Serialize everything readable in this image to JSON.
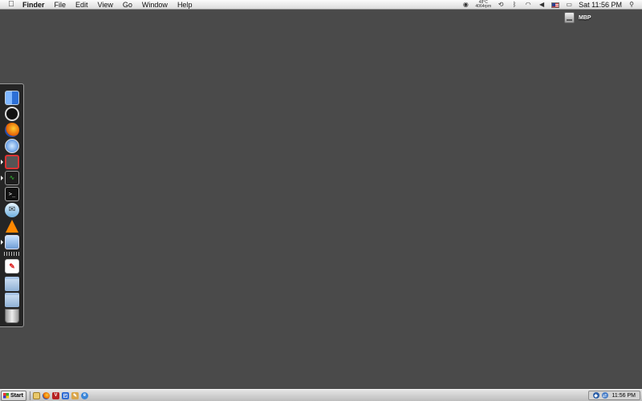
{
  "menubar": {
    "apple_icon": "apple-icon",
    "app_name": "Finder",
    "menus": [
      "File",
      "Edit",
      "View",
      "Go",
      "Window",
      "Help"
    ],
    "temperature": "48°C",
    "fan_speed": "4064rpm",
    "clock": "Sat 11:56 PM"
  },
  "desktop": {
    "disk_label": "MBP"
  },
  "dock": {
    "items": [
      {
        "name": "finder",
        "icon": "finder-icon",
        "running": true,
        "glyph": "☺"
      },
      {
        "name": "dashboard",
        "icon": "dashboard-icon",
        "running": false,
        "glyph": "◷"
      },
      {
        "name": "firefox",
        "icon": "firefox-icon",
        "running": false,
        "glyph": ""
      },
      {
        "name": "safari",
        "icon": "safari-icon",
        "running": false,
        "glyph": "✦"
      },
      {
        "name": "vmware",
        "icon": "vmware-icon",
        "running": true,
        "glyph": "⧉"
      },
      {
        "name": "activity-monitor",
        "icon": "activity-monitor-icon",
        "running": false,
        "glyph": "∿"
      },
      {
        "name": "terminal",
        "icon": "terminal-icon",
        "running": false,
        "glyph": ">_"
      },
      {
        "name": "ichat",
        "icon": "ichat-icon",
        "running": false,
        "glyph": "✉"
      },
      {
        "name": "vlc",
        "icon": "vlc-icon",
        "running": false,
        "glyph": ""
      },
      {
        "name": "network-app",
        "icon": "network-icon",
        "running": true,
        "glyph": "▣"
      },
      {
        "name": "adobe-reader",
        "icon": "pdf-icon",
        "running": false,
        "glyph": "✎"
      },
      {
        "name": "applications-folder",
        "icon": "folder-icon",
        "running": false,
        "glyph": ""
      },
      {
        "name": "documents-folder",
        "icon": "folder-icon",
        "running": false,
        "glyph": ""
      },
      {
        "name": "trash",
        "icon": "trash-icon",
        "running": false,
        "glyph": ""
      }
    ]
  },
  "taskbar": {
    "start_label": "Start",
    "quick_launch": [
      "show-desktop-icon",
      "firefox-icon",
      "v-app-icon",
      "outlook-icon",
      "paint-icon",
      "internet-explorer-icon"
    ],
    "tray_clock": "11:56 PM"
  }
}
